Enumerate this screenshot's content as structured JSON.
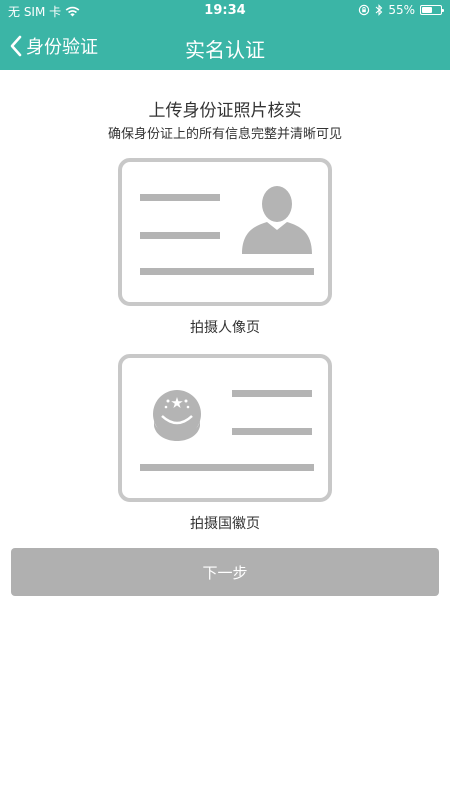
{
  "status_bar": {
    "carrier": "无 SIM 卡",
    "time": "19:34",
    "battery_percent": "55%",
    "battery_level": 0.55,
    "icons": [
      "wifi-icon",
      "orientation-lock-icon",
      "bluetooth-icon",
      "battery-icon"
    ]
  },
  "nav": {
    "back_label": "身份验证",
    "title": "实名认证"
  },
  "main": {
    "heading": "上传身份证照片核实",
    "subheading": "确保身份证上的所有信息完整并清晰可见",
    "cards": [
      {
        "caption": "拍摄人像页",
        "icon": "portrait-silhouette-icon"
      },
      {
        "caption": "拍摄国徽页",
        "icon": "national-emblem-icon"
      }
    ],
    "next_button": "下一步"
  },
  "colors": {
    "primary": "#3bb5a6",
    "card_border": "#c8c8c8",
    "placeholder_gray": "#b4b4b4",
    "button_disabled": "#b0b0b0",
    "text": "#333333"
  }
}
